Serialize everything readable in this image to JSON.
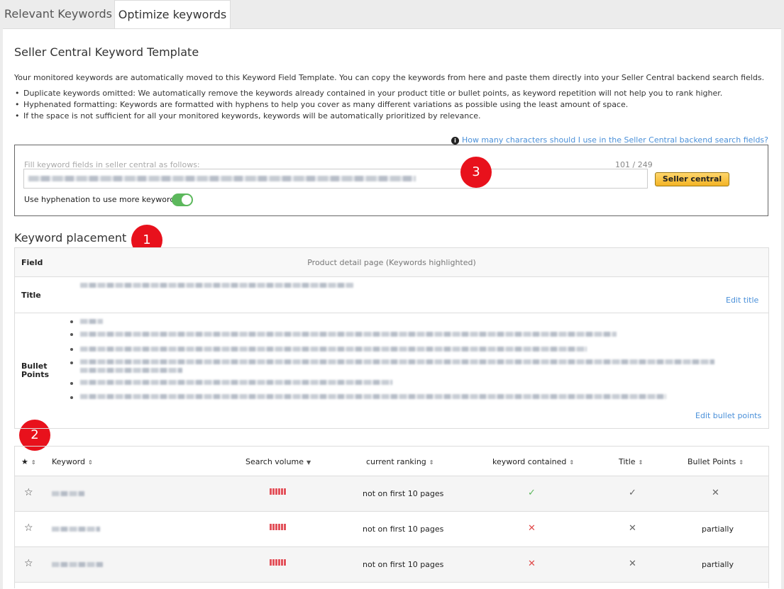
{
  "tabs": [
    {
      "label": "Relevant Keywords"
    },
    {
      "label": "Optimize keywords"
    }
  ],
  "header": {
    "title": "Seller Central Keyword Template",
    "intro": "Your monitored keywords are automatically moved to this Keyword Field Template. You can copy the keywords from here and paste them directly into your Seller Central backend search fields.",
    "bullets": [
      "Duplicate keywords omitted: We automatically remove the keywords already contained in your product title or bullet points, as keyword repetition will not help you to rank higher.",
      "Hyphenated formatting: Keywords are formatted with hyphens to help you cover as many different variations as possible using the least amount of space.",
      "If the space is not sufficient for all your monitored keywords, keywords will be automatically prioritized by relevance."
    ],
    "help_link": "How many characters should I use in the Seller Central backend search fields?"
  },
  "keyword_field": {
    "label": "Fill keyword fields in seller central as follows:",
    "count": "101 / 249",
    "seller_button": "Seller central",
    "hyphenation_label": "Use hyphenation to use more keywords",
    "hyphenation_on": true
  },
  "badges": {
    "one": "1",
    "two": "2",
    "three": "3"
  },
  "placement": {
    "title": "Keyword placement",
    "col_field": "Field",
    "col_page": "Product detail page (Keywords highlighted)",
    "row_title": "Title",
    "row_bullets": "Bullet Points",
    "edit_title": "Edit title",
    "edit_bullets": "Edit bullet points"
  },
  "keywords_table": {
    "headers": {
      "star": "★",
      "keyword": "Keyword",
      "search_volume": "Search volume",
      "ranking": "current ranking",
      "contained": "keyword contained",
      "title": "Title",
      "bullets": "Bullet Points"
    },
    "rows": [
      {
        "ranking": "not on first 10 pages",
        "contained": "✓",
        "title": "✓",
        "bullets": "✕"
      },
      {
        "ranking": "not on first 10 pages",
        "contained": "✕",
        "title": "✕",
        "bullets": "partially"
      },
      {
        "ranking": "not on first 10 pages",
        "contained": "✕",
        "title": "✕",
        "bullets": "partially"
      }
    ]
  },
  "colors": {
    "accent_link": "#4a90d9",
    "badge_red": "#e8111c",
    "toggle_green": "#5cb85c",
    "volume_red": "#e2525b"
  }
}
